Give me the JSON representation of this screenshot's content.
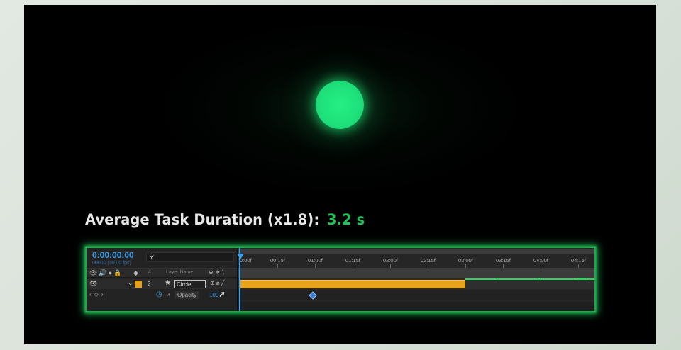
{
  "caption": {
    "label": "Average Task Duration (x1.8):",
    "value": "3.2 s"
  },
  "colors": {
    "accent_green": "#22c35a",
    "circle_green": "#1ee07a",
    "timecode_blue": "#3f9fe8",
    "layer_orange": "#e9a21c"
  },
  "timeline": {
    "timecode": "0:00:00:00",
    "fps": "00000 (30.00 fps)",
    "search_icon": "search-icon",
    "header": {
      "switch_icons": "👁🔊●🔒",
      "tag_icon": "tag-icon",
      "num_col": "#",
      "layer_name_col": "Layer Name",
      "switches": "⊕✲\\"
    },
    "layer": {
      "number": "2",
      "name": "Circle",
      "label_color": "#e9a21c"
    },
    "property": {
      "label": "Opacity",
      "value": "100"
    },
    "ruler_ticks": [
      "0:00f",
      "00:15f",
      "01:00f",
      "01:15f",
      "02:00f",
      "02:15f",
      "03:00f",
      "03:15f",
      "04:00f",
      "04:15f"
    ]
  }
}
